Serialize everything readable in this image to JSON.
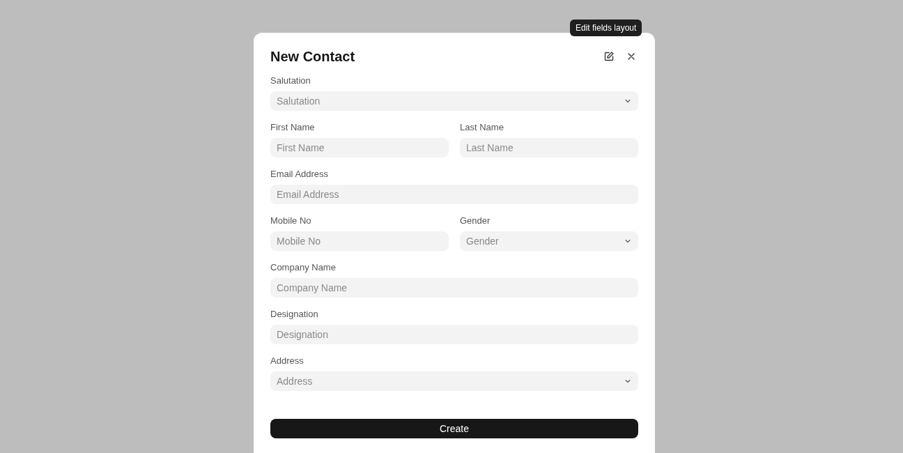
{
  "dialog": {
    "title": "New Contact",
    "tooltip": "Edit fields layout",
    "rows": [
      [
        {
          "label": "Salutation",
          "placeholder": "Salutation",
          "kind": "select"
        }
      ],
      [
        {
          "label": "First Name",
          "placeholder": "First Name",
          "kind": "input"
        },
        {
          "label": "Last Name",
          "placeholder": "Last Name",
          "kind": "input"
        }
      ],
      [
        {
          "label": "Email Address",
          "placeholder": "Email Address",
          "kind": "input"
        }
      ],
      [
        {
          "label": "Mobile No",
          "placeholder": "Mobile No",
          "kind": "input"
        },
        {
          "label": "Gender",
          "placeholder": "Gender",
          "kind": "select"
        }
      ],
      [
        {
          "label": "Company Name",
          "placeholder": "Company Name",
          "kind": "input"
        }
      ],
      [
        {
          "label": "Designation",
          "placeholder": "Designation",
          "kind": "input"
        }
      ],
      [
        {
          "label": "Address",
          "placeholder": "Address",
          "kind": "select"
        }
      ]
    ],
    "submit": "Create"
  }
}
